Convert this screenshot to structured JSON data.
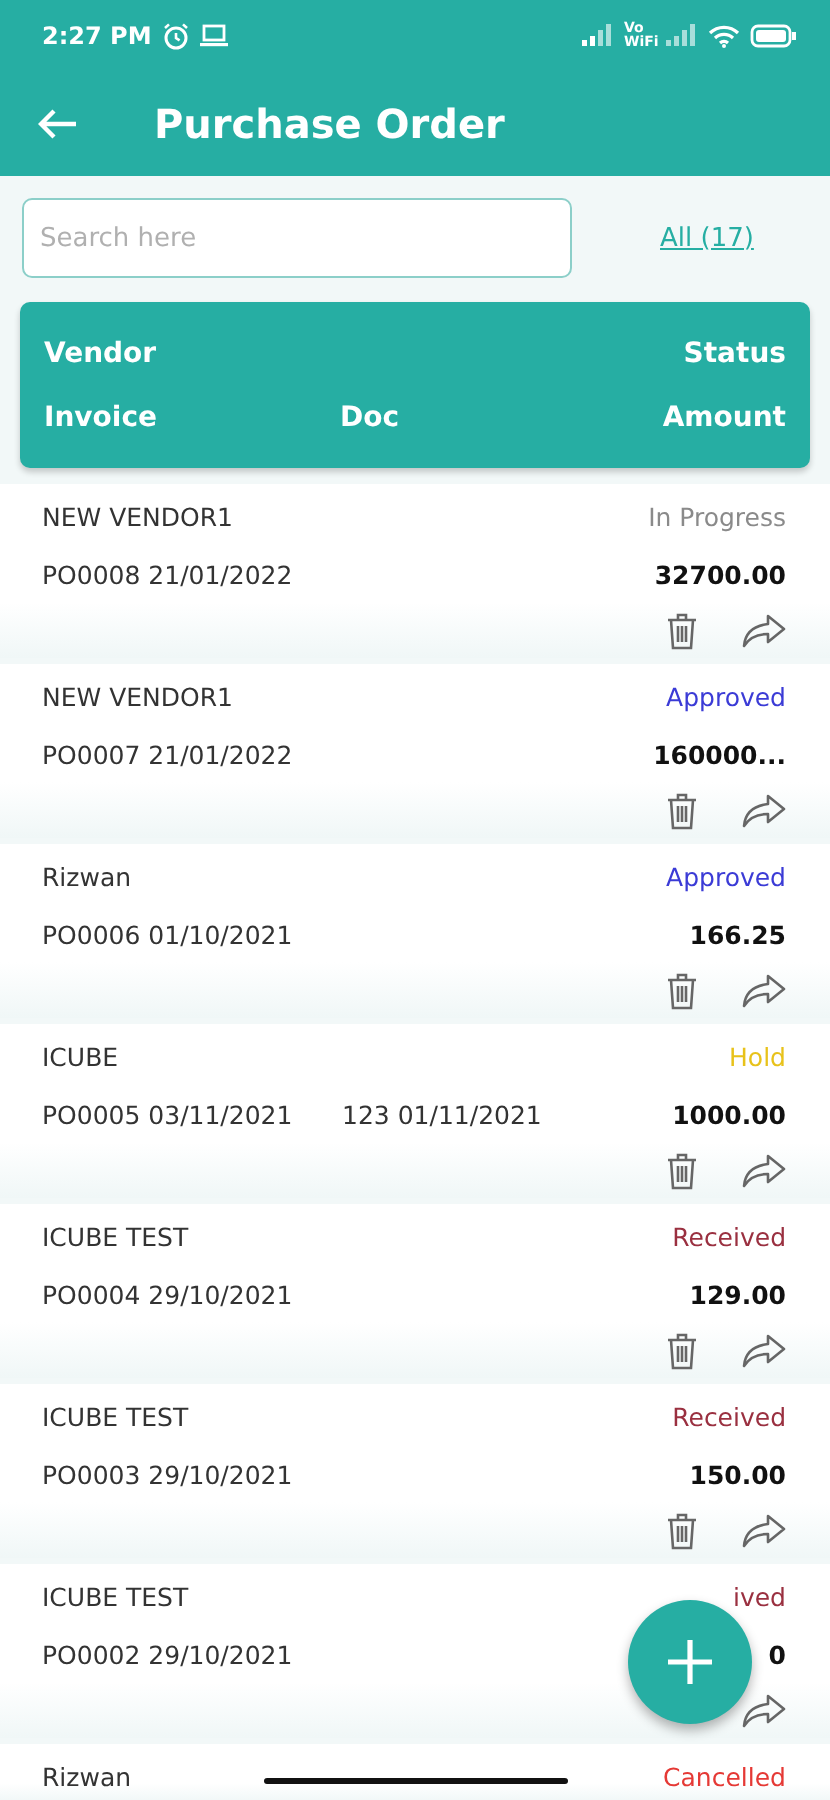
{
  "status_bar": {
    "time": "2:27 PM",
    "network_label": "Vo WiFi"
  },
  "app_bar": {
    "title": "Purchase Order"
  },
  "search": {
    "placeholder": "Search here"
  },
  "filter_link": "All (17)",
  "header": {
    "vendor": "Vendor",
    "status": "Status",
    "invoice": "Invoice",
    "doc": "Doc",
    "amount": "Amount"
  },
  "orders": [
    {
      "vendor": "NEW VENDOR1",
      "status": "In Progress",
      "color": "#8a8a8a",
      "invoice": "PO0008 21/01/2022",
      "amount": "32700.00"
    },
    {
      "vendor": "NEW VENDOR1",
      "status": "Approved",
      "color": "#3b3bd6",
      "invoice": "PO0007 21/01/2022",
      "amount": "160000..."
    },
    {
      "vendor": "Rizwan",
      "status": "Approved",
      "color": "#3b3bd6",
      "invoice": "PO0006 01/10/2021",
      "amount": "166.25"
    },
    {
      "vendor": "ICUBE",
      "status": "Hold",
      "color": "#e8c21a",
      "invoice": "PO0005 03/11/2021",
      "doc": "123 01/11/2021",
      "amount": "1000.00"
    },
    {
      "vendor": "ICUBE TEST",
      "status": "Received",
      "color": "#9a3040",
      "invoice": "PO0004 29/10/2021",
      "amount": "129.00"
    },
    {
      "vendor": "ICUBE TEST",
      "status": "Received",
      "color": "#9a3040",
      "invoice": "PO0003 29/10/2021",
      "amount": "150.00"
    },
    {
      "vendor": "ICUBE TEST",
      "status": "ived",
      "color": "#9a3040",
      "invoice": "PO0002 29/10/2021",
      "amount": "0",
      "delete_hidden": true
    },
    {
      "vendor": "Rizwan",
      "status": "Cancelled",
      "color": "#e53935"
    }
  ]
}
